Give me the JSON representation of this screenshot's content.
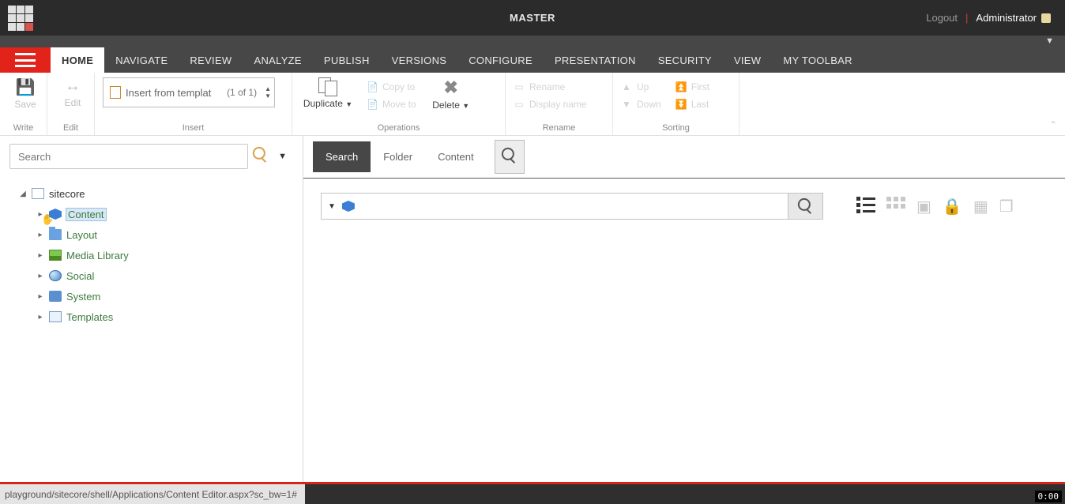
{
  "topbar": {
    "title": "MASTER",
    "logout": "Logout",
    "user": "Administrator"
  },
  "nav": {
    "tabs": [
      "HOME",
      "NAVIGATE",
      "REVIEW",
      "ANALYZE",
      "PUBLISH",
      "VERSIONS",
      "CONFIGURE",
      "PRESENTATION",
      "SECURITY",
      "VIEW",
      "MY TOOLBAR"
    ],
    "active": "HOME"
  },
  "ribbon": {
    "write": {
      "label": "Write",
      "save": "Save",
      "edit": "Edit"
    },
    "edit_group": {
      "label": "Edit",
      "edit": "Edit"
    },
    "insert": {
      "label": "Insert",
      "template_label": "Insert from templat",
      "count": "(1 of 1)"
    },
    "operations": {
      "label": "Operations",
      "duplicate": "Duplicate",
      "copy_to": "Copy to",
      "move_to": "Move to",
      "delete": "Delete"
    },
    "rename": {
      "label": "Rename",
      "rename": "Rename",
      "display_name": "Display name"
    },
    "sorting": {
      "label": "Sorting",
      "up": "Up",
      "down": "Down",
      "first": "First",
      "last": "Last"
    }
  },
  "sidebar": {
    "search_placeholder": "Search",
    "tree": {
      "root": "sitecore",
      "children": [
        {
          "label": "Content",
          "icon": "cube",
          "selected": true
        },
        {
          "label": "Layout",
          "icon": "folder"
        },
        {
          "label": "Media Library",
          "icon": "image"
        },
        {
          "label": "Social",
          "icon": "globe"
        },
        {
          "label": "System",
          "icon": "gear"
        },
        {
          "label": "Templates",
          "icon": "tmpl"
        }
      ]
    }
  },
  "main": {
    "tabs": [
      "Search",
      "Folder",
      "Content"
    ],
    "active_tab": "Search"
  },
  "status": {
    "url": "playground/sitecore/shell/Applications/Content Editor.aspx?sc_bw=1#",
    "clock": "0:00"
  }
}
